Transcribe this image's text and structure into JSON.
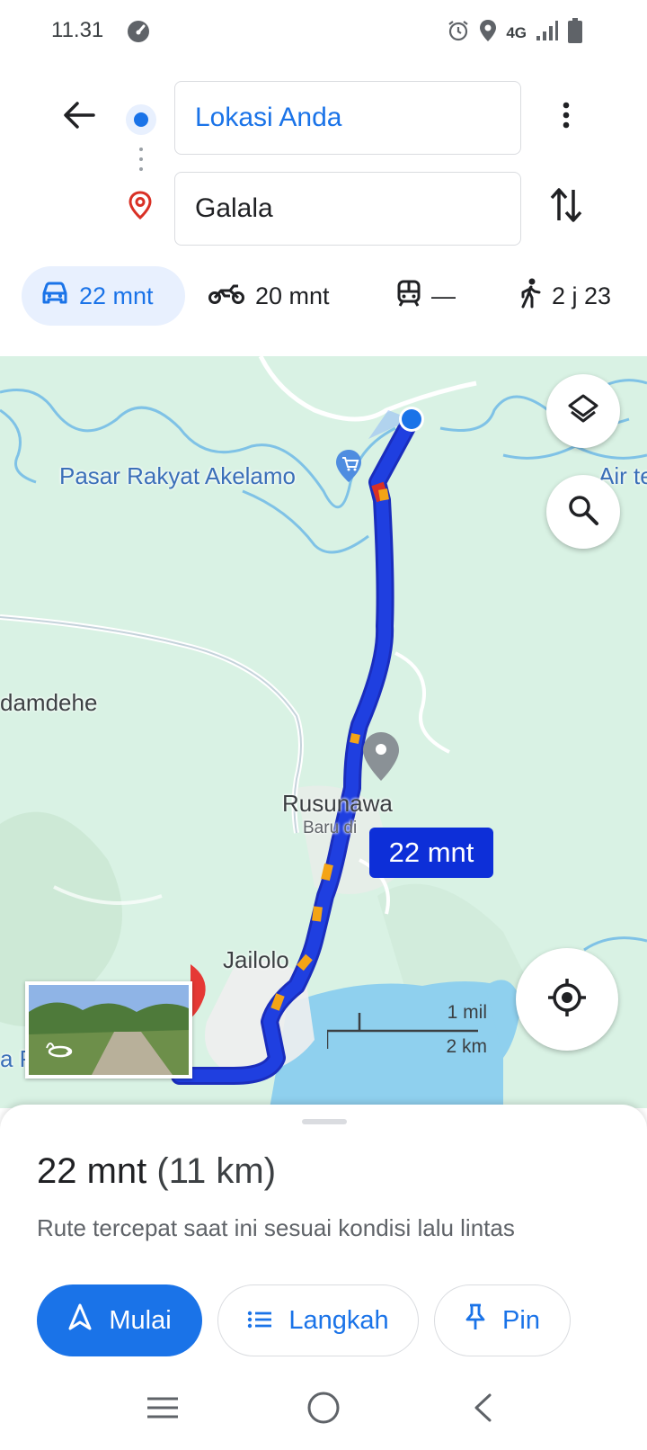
{
  "status_bar": {
    "time": "11.31",
    "network": "4G",
    "icons": [
      "speedometer-icon",
      "alarm-icon",
      "location-icon",
      "signal-icon",
      "battery-icon"
    ]
  },
  "search": {
    "origin": "Lokasi Anda",
    "destination": "Galala",
    "icons": [
      "back-arrow-icon",
      "origin-dot-icon",
      "destination-pin-icon",
      "more-vert-icon",
      "swap-icon"
    ]
  },
  "travel_modes": [
    {
      "icon": "car-icon",
      "label": "22 mnt",
      "selected": true
    },
    {
      "icon": "motorcycle-icon",
      "label": "20 mnt",
      "selected": false
    },
    {
      "icon": "transit-icon",
      "label": "—",
      "selected": false
    },
    {
      "icon": "walk-icon",
      "label": "2 j 23",
      "selected": false
    }
  ],
  "map": {
    "labels": {
      "market": "Pasar Rakyat Akelamo",
      "air_te": "Air te",
      "damdehe": "damdehe",
      "rusunawa": "Rusunawa",
      "baru_di": "Baru di",
      "jailolo": "Jailolo",
      "pelangi": "a Pelangi"
    },
    "route_duration": "22 mnt",
    "scale": {
      "imperial": "1 mil",
      "metric": "2 km"
    },
    "colors": {
      "route": "#1f3fe0",
      "traffic_slow": "#f4a416",
      "water": "#8fd0ee",
      "land": "#d9f2e4"
    },
    "icons": [
      "layers-icon",
      "search-icon",
      "my-location-icon",
      "shopping-cart-icon",
      "place-pin-icon"
    ]
  },
  "bottom_sheet": {
    "duration": "22 mnt",
    "distance": "(11 km)",
    "description": "Rute tercepat saat ini sesuai kondisi lalu lintas",
    "buttons": {
      "start": "Mulai",
      "steps": "Langkah",
      "pin": "Pin"
    }
  },
  "nav_bar": {
    "icons": [
      "recent-apps-icon",
      "home-icon",
      "back-icon"
    ]
  }
}
